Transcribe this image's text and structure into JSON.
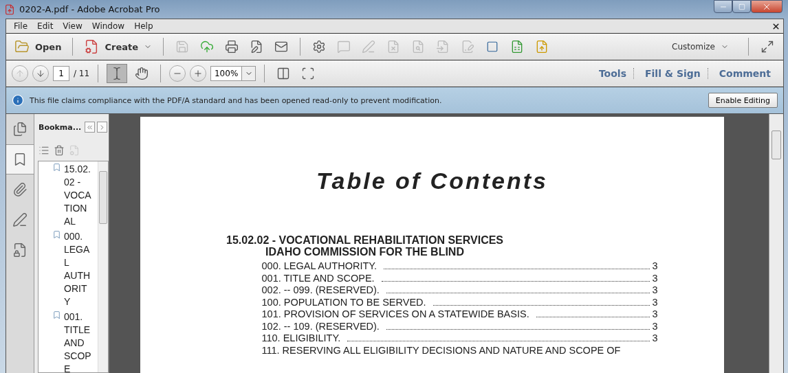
{
  "window": {
    "title": "0202-A.pdf - Adobe Acrobat Pro"
  },
  "menu": [
    "File",
    "Edit",
    "View",
    "Window",
    "Help"
  ],
  "toolbar": {
    "open": "Open",
    "create": "Create",
    "customize": "Customize"
  },
  "navigation": {
    "page": "1",
    "total": "/ 11",
    "zoom": "100%",
    "tools": [
      {
        "kind": "select",
        "selected": true
      },
      {
        "kind": "hand",
        "selected": false
      }
    ]
  },
  "panes": [
    "Tools",
    "Fill & Sign",
    "Comment"
  ],
  "info_bar": {
    "message": "This file claims compliance with the PDF/A standard and has been opened read-only to prevent modification.",
    "button": "Enable Editing"
  },
  "side_tabs": [
    {
      "kind": "pages",
      "selected": false
    },
    {
      "kind": "bookmarks",
      "selected": true
    },
    {
      "kind": "attachments",
      "selected": false
    },
    {
      "kind": "signatures",
      "selected": false
    },
    {
      "kind": "security",
      "selected": false
    }
  ],
  "bookmarks": {
    "title": "Bookma...",
    "items": [
      "15.02.02 - VOCATIONAL",
      "000. LEGAL AUTHORITY",
      "001. TITLE AND SCOPE"
    ]
  },
  "document": {
    "heading": "Table of Contents",
    "section": [
      "15.02.02 - VOCATIONAL REHABILITATION SERVICES",
      "IDAHO COMMISSION FOR THE BLIND"
    ],
    "entries": [
      {
        "title": "000. LEGAL AUTHORITY.",
        "page": "3"
      },
      {
        "title": "001. TITLE AND SCOPE.",
        "page": "3"
      },
      {
        "title": "002. -- 099. (RESERVED).",
        "page": "3"
      },
      {
        "title": "100. POPULATION TO BE SERVED.",
        "page": "3"
      },
      {
        "title": "101. PROVISION OF SERVICES ON A STATEWIDE BASIS.",
        "page": "3"
      },
      {
        "title": "102. -- 109. (RESERVED).",
        "page": "3"
      },
      {
        "title": "110. ELIGIBILITY.",
        "page": "3"
      },
      {
        "title": "111. RESERVING ALL ELIGIBILITY DECISIONS AND NATURE AND SCOPE OF"
      }
    ]
  }
}
